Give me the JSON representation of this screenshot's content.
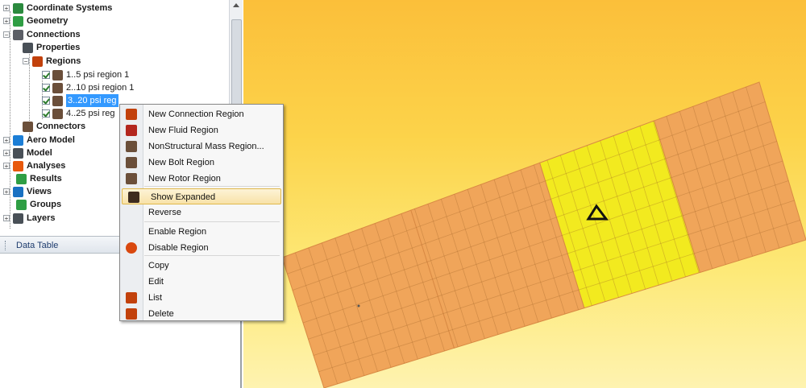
{
  "tree": {
    "items": [
      {
        "label": "Coordinate Systems",
        "icon": "coordinate-axes-icon",
        "color": "#2b8a3e"
      },
      {
        "label": "Geometry",
        "icon": "geometry-cylinder-icon",
        "color": "#2f9e44"
      },
      {
        "label": "Connections",
        "icon": "connections-plug-icon",
        "color": "#5c5f66"
      },
      {
        "label": "Properties",
        "icon": "properties-icon",
        "color": "#495057"
      },
      {
        "label": "Regions",
        "icon": "regions-folder-icon",
        "color": "#c2410c"
      },
      {
        "label": "1..5 psi region 1",
        "icon": "region-person-icon",
        "color": "#6b4f3a"
      },
      {
        "label": "2..10 psi region 1",
        "icon": "region-person-icon",
        "color": "#6b4f3a"
      },
      {
        "label": "3..20 psi reg",
        "icon": "region-person-icon",
        "color": "#6b4f3a"
      },
      {
        "label": "4..25 psi reg",
        "icon": "region-person-icon",
        "color": "#6b4f3a"
      },
      {
        "label": "Connectors",
        "icon": "connectors-icon",
        "color": "#6b4f3a"
      },
      {
        "label": "Aero Model",
        "icon": "aero-model-icon",
        "color": "#1c7ed6"
      },
      {
        "label": "Model",
        "icon": "model-grid-icon",
        "color": "#495057"
      },
      {
        "label": "Analyses",
        "icon": "analyses-icon",
        "color": "#e8590c"
      },
      {
        "label": "Results",
        "icon": "results-icon",
        "color": "#2f9e44"
      },
      {
        "label": "Views",
        "icon": "views-icon",
        "color": "#1971c2"
      },
      {
        "label": "Groups",
        "icon": "groups-icon",
        "color": "#2f9e44"
      },
      {
        "label": "Layers",
        "icon": "layers-icon",
        "color": "#495057"
      }
    ]
  },
  "data_table": {
    "title": "Data Table"
  },
  "context_menu": {
    "items": [
      {
        "label": "New Connection Region",
        "icon": "connection-region-icon",
        "color": "#c2410c"
      },
      {
        "label": "New Fluid Region",
        "icon": "fluid-region-icon",
        "color": "#b3261e"
      },
      {
        "label": "NonStructural Mass Region...",
        "icon": "mass-region-icon",
        "color": "#6b4f3a"
      },
      {
        "label": "New Bolt Region",
        "icon": "bolt-region-icon",
        "color": "#6b4f3a"
      },
      {
        "label": "New Rotor Region",
        "icon": "rotor-region-icon",
        "color": "#6b4f3a"
      },
      {
        "label": "Show Expanded",
        "icon": "show-expanded-icon",
        "color": "#3d2b1f"
      },
      {
        "label": "Reverse",
        "icon": "",
        "color": ""
      },
      {
        "label": "Enable Region",
        "icon": "",
        "color": ""
      },
      {
        "label": "Disable Region",
        "icon": "disable-region-icon",
        "color": "#d9480f"
      },
      {
        "label": "Copy",
        "icon": "",
        "color": ""
      },
      {
        "label": "Edit",
        "icon": "",
        "color": ""
      },
      {
        "label": "List",
        "icon": "list-icon",
        "color": "#c2410c"
      },
      {
        "label": "Delete",
        "icon": "delete-icon",
        "color": "#c2410c"
      }
    ]
  },
  "viewport": {
    "colors": {
      "strip": "#f0a55a",
      "highlight_region": "#f2ea1f",
      "mesh_line": "#d98a44"
    },
    "marker_icon": "triangle-marker-icon"
  }
}
